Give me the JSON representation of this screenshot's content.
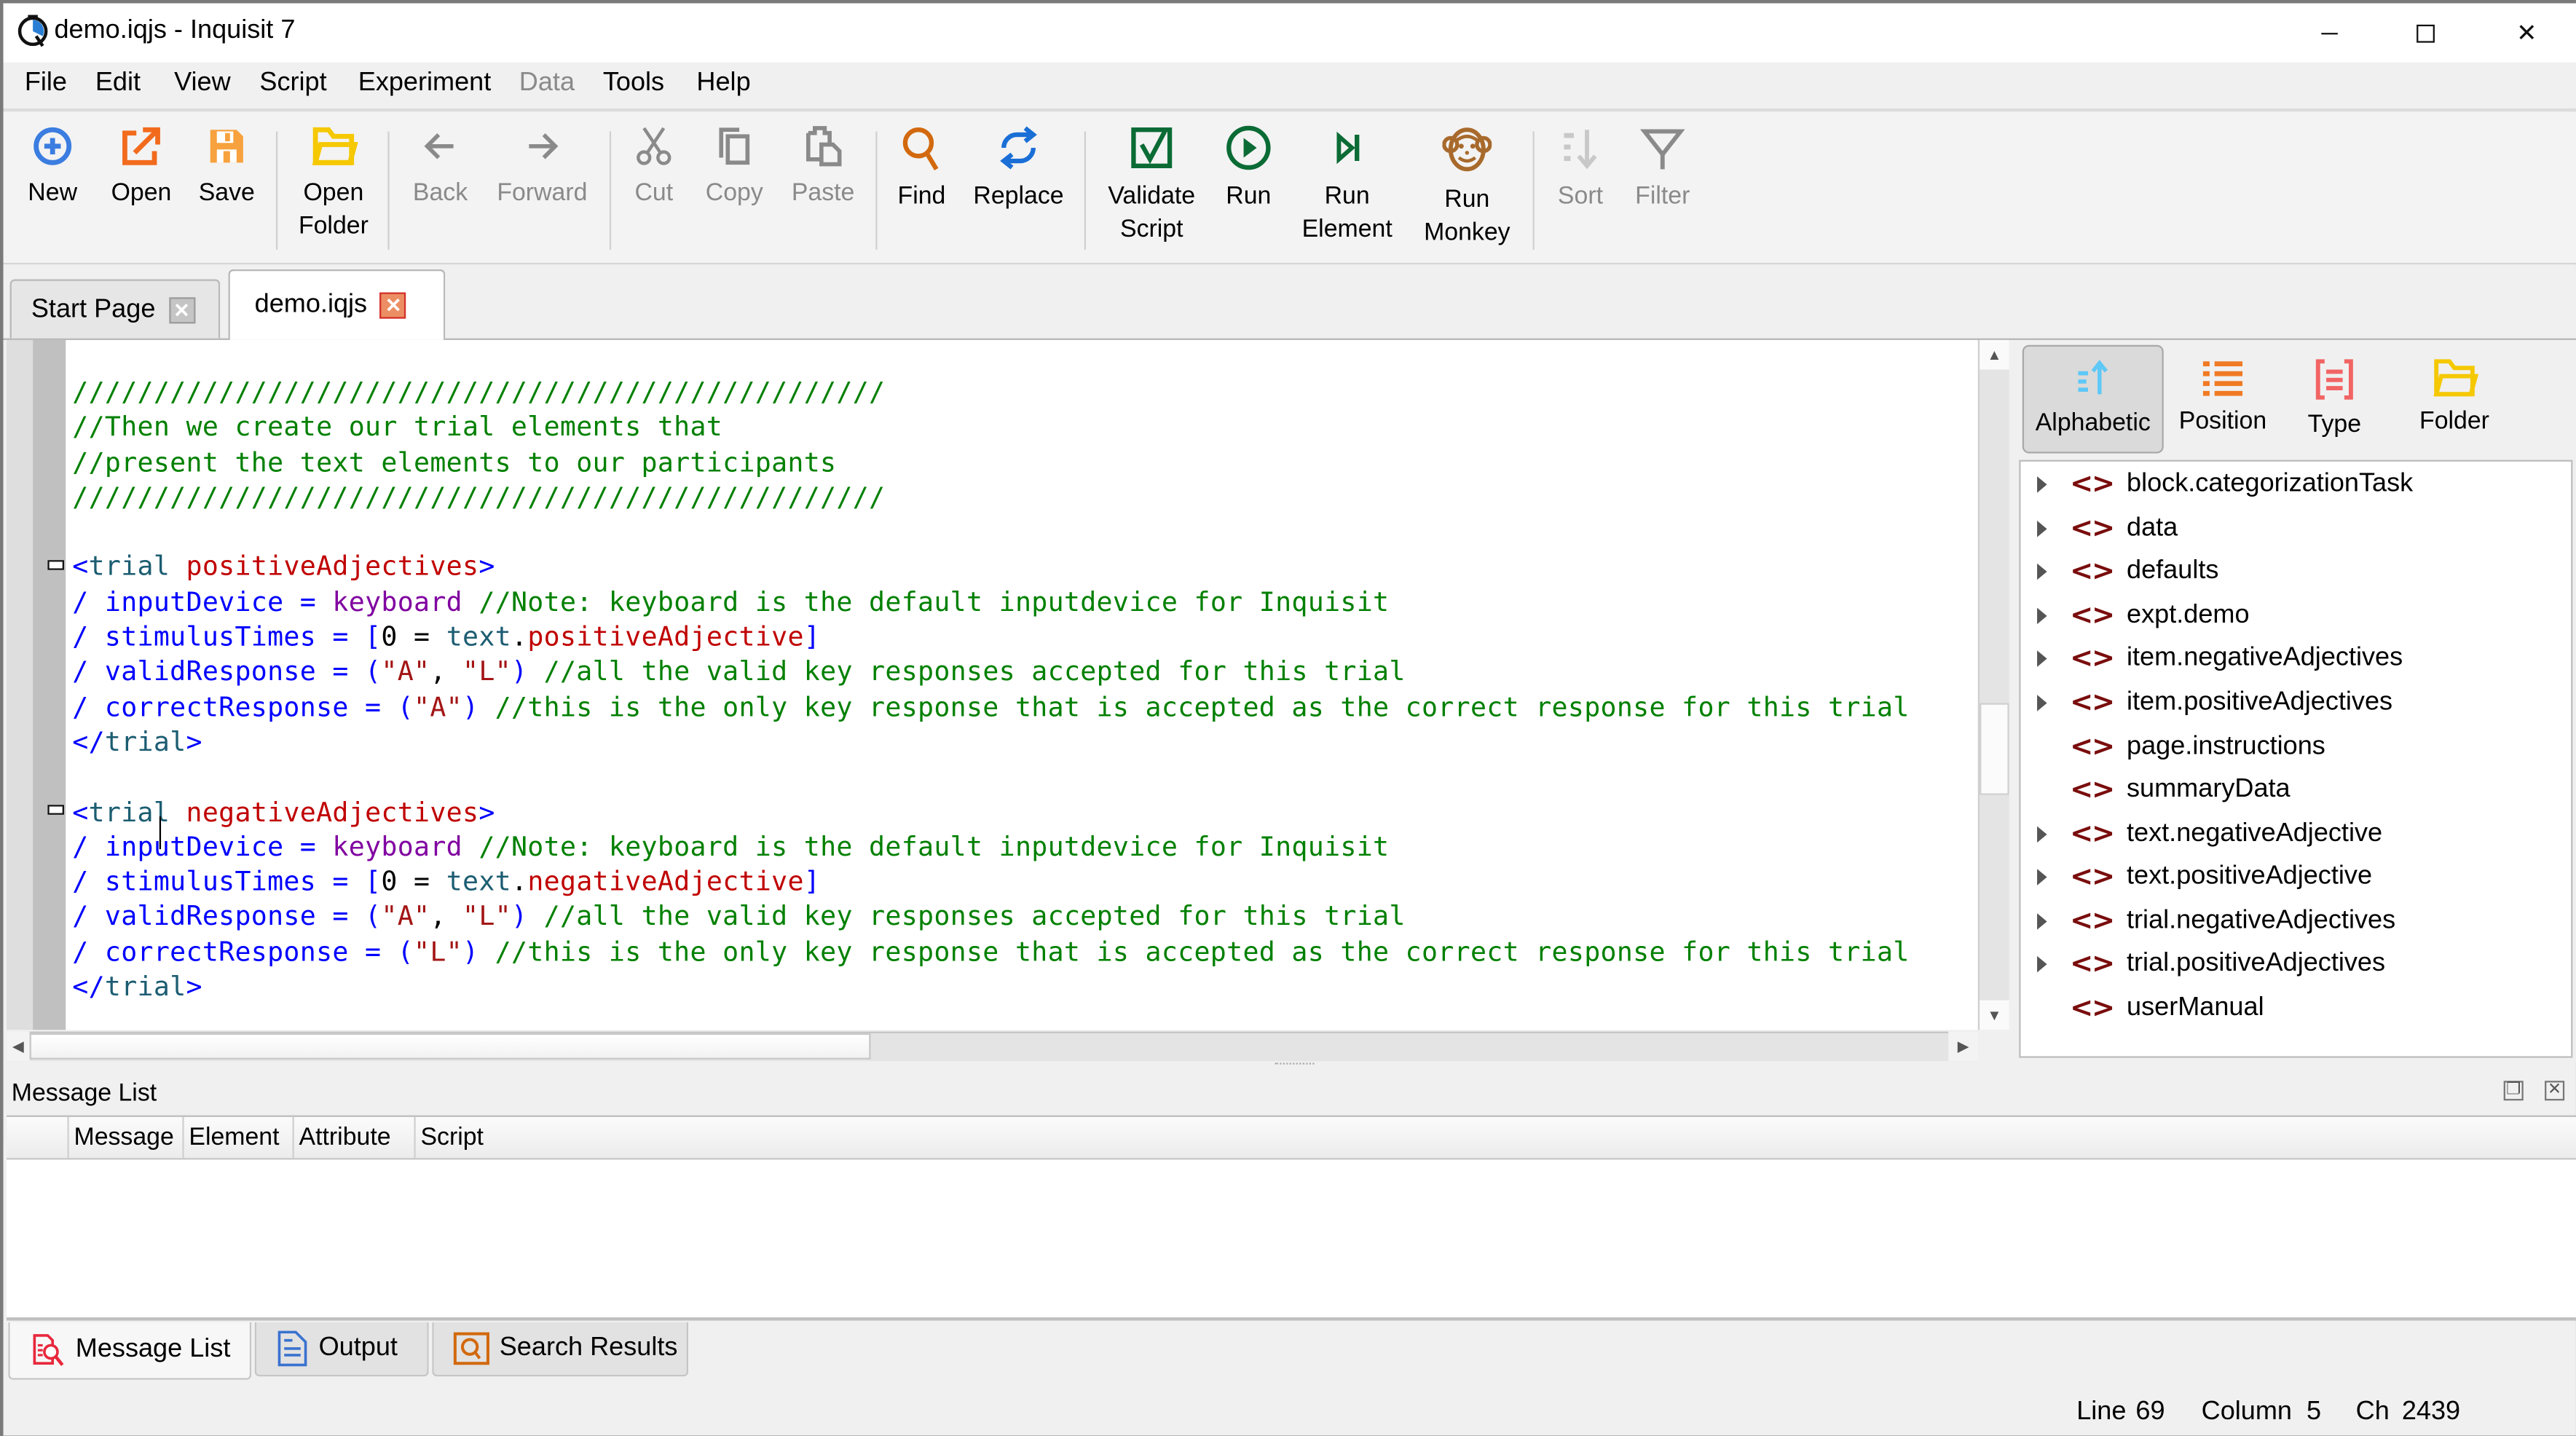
{
  "window": {
    "title": "demo.iqjs - Inquisit 7",
    "controls": {
      "minimize": "—",
      "maximize": "☐",
      "close": "✕"
    }
  },
  "menu": [
    {
      "label": "File",
      "enabled": true
    },
    {
      "label": "Edit",
      "enabled": true
    },
    {
      "label": "View",
      "enabled": true
    },
    {
      "label": "Script",
      "enabled": true
    },
    {
      "label": "Experiment",
      "enabled": true
    },
    {
      "label": "Data",
      "enabled": false
    },
    {
      "label": "Tools",
      "enabled": true
    },
    {
      "label": "Help",
      "enabled": true
    }
  ],
  "toolbar": {
    "new": {
      "line1": "New",
      "line2": "",
      "enabled": true,
      "icon": "new-icon",
      "color": "#3b7de0"
    },
    "open": {
      "line1": "Open",
      "line2": "",
      "enabled": true,
      "icon": "open-icon",
      "color": "#f26b1d"
    },
    "save": {
      "line1": "Save",
      "line2": "",
      "enabled": true,
      "icon": "save-icon",
      "color": "#f7a23e"
    },
    "open_folder": {
      "line1": "Open",
      "line2": "Folder",
      "enabled": true,
      "icon": "folder-icon",
      "color": "#f5c800"
    },
    "back": {
      "line1": "Back",
      "line2": "",
      "enabled": false,
      "icon": "arrow-left-icon"
    },
    "forward": {
      "line1": "Forward",
      "line2": "",
      "enabled": false,
      "icon": "arrow-right-icon"
    },
    "cut": {
      "line1": "Cut",
      "line2": "",
      "enabled": false,
      "icon": "scissors-icon"
    },
    "copy": {
      "line1": "Copy",
      "line2": "",
      "enabled": false,
      "icon": "copy-icon"
    },
    "paste": {
      "line1": "Paste",
      "line2": "",
      "enabled": false,
      "icon": "paste-icon"
    },
    "find": {
      "line1": "Find",
      "line2": "",
      "enabled": true,
      "icon": "search-icon",
      "color": "#d2690e"
    },
    "replace": {
      "line1": "Replace",
      "line2": "",
      "enabled": true,
      "icon": "replace-icon",
      "color": "#1a6fd6"
    },
    "validate": {
      "line1": "Validate",
      "line2": "Script",
      "enabled": true,
      "icon": "checkbox-icon",
      "color": "#0b6b35"
    },
    "run": {
      "line1": "Run",
      "line2": "",
      "enabled": true,
      "icon": "play-icon",
      "color": "#0b6b35"
    },
    "run_element": {
      "line1": "Run",
      "line2": "Element",
      "enabled": true,
      "icon": "step-icon",
      "color": "#0b6b35"
    },
    "run_monkey": {
      "line1": "Run",
      "line2": "Monkey",
      "enabled": true,
      "icon": "monkey-icon",
      "color": "#a86a2c"
    },
    "sort": {
      "line1": "Sort",
      "line2": "",
      "enabled": false,
      "icon": "sort-icon"
    },
    "filter": {
      "line1": "Filter",
      "line2": "",
      "enabled": false,
      "icon": "filter-icon"
    }
  },
  "tabs": [
    {
      "label": "Start Page",
      "active": false
    },
    {
      "label": "demo.iqjs",
      "active": true
    }
  ],
  "editor": {
    "lines": [
      [
        [
          "c-com",
          "//////////////////////////////////////////////////"
        ]
      ],
      [
        [
          "c-com",
          "//Then we create our trial elements that"
        ]
      ],
      [
        [
          "c-com",
          "//present the text elements to our participants"
        ]
      ],
      [
        [
          "c-com",
          "//////////////////////////////////////////////////"
        ]
      ],
      [],
      [
        [
          "c-blue",
          "<"
        ],
        [
          "c-teal",
          "trial "
        ],
        [
          "c-red",
          "positiveAdjectives"
        ],
        [
          "c-blue",
          ">"
        ]
      ],
      [
        [
          "c-blue",
          "/ inputDevice = "
        ],
        [
          "c-purple",
          "keyboard"
        ],
        [
          "c-com",
          " //Note: keyboard is the default inputdevice for Inquisit"
        ]
      ],
      [
        [
          "c-blue",
          "/ stimulusTimes = ["
        ],
        [
          "c-blk",
          "0 = "
        ],
        [
          "c-teal",
          "text"
        ],
        [
          "c-blk",
          "."
        ],
        [
          "c-red",
          "positiveAdjective"
        ],
        [
          "c-blue",
          "]"
        ]
      ],
      [
        [
          "c-blue",
          "/ validResponse = ("
        ],
        [
          "c-str",
          "\"A\""
        ],
        [
          "c-blk",
          ", "
        ],
        [
          "c-str",
          "\"L\""
        ],
        [
          "c-blue",
          ")"
        ],
        [
          "c-com",
          " //all the valid key responses accepted for this trial"
        ]
      ],
      [
        [
          "c-blue",
          "/ correctResponse = ("
        ],
        [
          "c-str",
          "\"A\""
        ],
        [
          "c-blue",
          ")"
        ],
        [
          "c-com",
          " //this is the only key response that is accepted as the correct response for this trial"
        ]
      ],
      [
        [
          "c-blue",
          "</"
        ],
        [
          "c-teal",
          "trial"
        ],
        [
          "c-blue",
          ">"
        ]
      ],
      [],
      [
        [
          "c-blue",
          "<"
        ],
        [
          "c-teal",
          "trial "
        ],
        [
          "c-red",
          "negativeAdjectives"
        ],
        [
          "c-blue",
          ">"
        ]
      ],
      [
        [
          "c-blue",
          "/ inputDevice = "
        ],
        [
          "c-purple",
          "keyboard"
        ],
        [
          "c-com",
          " //Note: keyboard is the default inputdevice for Inquisit"
        ]
      ],
      [
        [
          "c-blue",
          "/ stimulusTimes = ["
        ],
        [
          "c-blk",
          "0 = "
        ],
        [
          "c-teal",
          "text"
        ],
        [
          "c-blk",
          "."
        ],
        [
          "c-red",
          "negativeAdjective"
        ],
        [
          "c-blue",
          "]"
        ]
      ],
      [
        [
          "c-blue",
          "/ validResponse = ("
        ],
        [
          "c-str",
          "\"A\""
        ],
        [
          "c-blk",
          ", "
        ],
        [
          "c-str",
          "\"L\""
        ],
        [
          "c-blue",
          ")"
        ],
        [
          "c-com",
          " //all the valid key responses accepted for this trial"
        ]
      ],
      [
        [
          "c-blue",
          "/ correctResponse = ("
        ],
        [
          "c-str",
          "\"L\""
        ],
        [
          "c-blue",
          ")"
        ],
        [
          "c-com",
          " //this is the only key response that is accepted as the correct response for this trial"
        ]
      ],
      [
        [
          "c-blue",
          "</"
        ],
        [
          "c-teal",
          "trial"
        ],
        [
          "c-blue",
          ">"
        ]
      ]
    ],
    "vertical_scroll_fraction": 0.62,
    "horizontal_scroll_fraction": 0.0
  },
  "element_panel": {
    "sort_buttons": [
      {
        "label": "Alphabetic",
        "active": true,
        "icon": "sort-alpha-icon",
        "color": "#5ec8f7"
      },
      {
        "label": "Position",
        "active": false,
        "icon": "list-icon",
        "color": "#f07a24"
      },
      {
        "label": "Type",
        "active": false,
        "icon": "type-icon",
        "color": "#f26464"
      },
      {
        "label": "Folder",
        "active": false,
        "icon": "folder-icon",
        "color": "#f5c800"
      }
    ],
    "items": [
      {
        "label": "block.categorizationTask",
        "expandable": true
      },
      {
        "label": "data",
        "expandable": true
      },
      {
        "label": "defaults",
        "expandable": true
      },
      {
        "label": "expt.demo",
        "expandable": true
      },
      {
        "label": "item.negativeAdjectives",
        "expandable": true
      },
      {
        "label": "item.positiveAdjectives",
        "expandable": true
      },
      {
        "label": "page.instructions",
        "expandable": false
      },
      {
        "label": "summaryData",
        "expandable": false
      },
      {
        "label": "text.negativeAdjective",
        "expandable": true
      },
      {
        "label": "text.positiveAdjective",
        "expandable": true
      },
      {
        "label": "trial.negativeAdjectives",
        "expandable": true
      },
      {
        "label": "trial.positiveAdjectives",
        "expandable": true
      },
      {
        "label": "userManual",
        "expandable": false
      }
    ]
  },
  "message_list": {
    "title": "Message List",
    "columns": [
      "Message",
      "Element",
      "Attribute",
      "Script"
    ],
    "rows": []
  },
  "bottom_tabs": [
    {
      "label": "Message List",
      "active": true,
      "icon": "message-list-icon",
      "color": "#e8283c"
    },
    {
      "label": "Output",
      "active": false,
      "icon": "document-icon",
      "color": "#3a72d0"
    },
    {
      "label": "Search Results",
      "active": false,
      "icon": "search-results-icon",
      "color": "#d2690e"
    }
  ],
  "status": {
    "line_label": "Line",
    "line": "69",
    "column_label": "Column",
    "column": "5",
    "ch_label": "Ch",
    "ch": "2439"
  }
}
